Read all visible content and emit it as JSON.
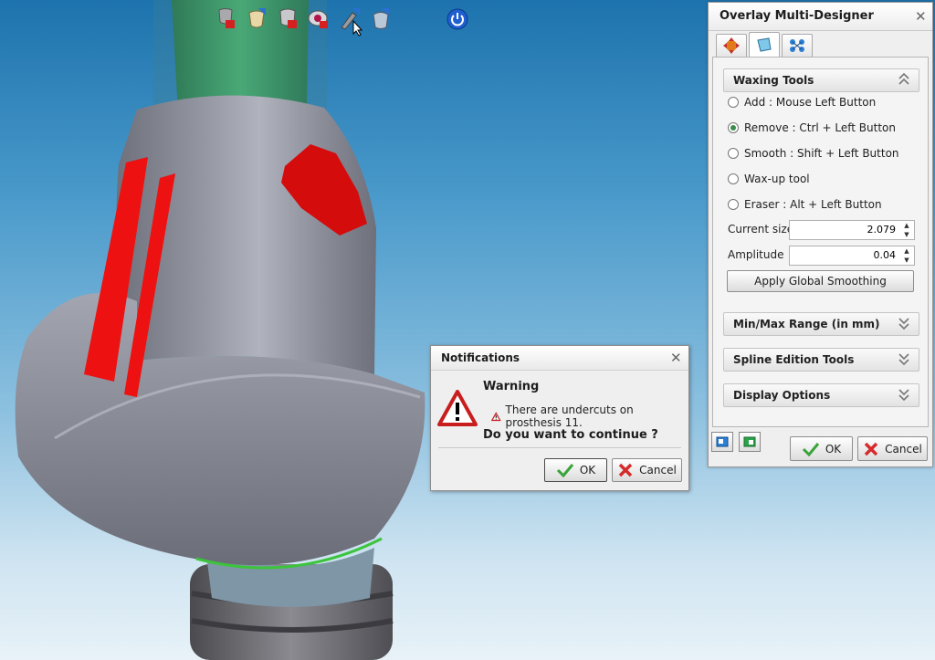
{
  "toolbar": {
    "icons": [
      "tooth-remove-icon",
      "tooth-add-icon",
      "tooth-cut-icon",
      "tooth-view-icon",
      "wax-pen-icon",
      "tooth-shape-icon",
      "power-icon"
    ]
  },
  "panel": {
    "title": "Overlay Multi-Designer",
    "tabs": [
      "move-icon",
      "wax-tool-icon",
      "nodes-icon"
    ],
    "active_tab": 1,
    "waxing": {
      "header": "Waxing Tools",
      "options": [
        {
          "label": "Add : Mouse Left Button",
          "selected": false
        },
        {
          "label": "Remove : Ctrl + Left Button",
          "selected": true
        },
        {
          "label": "Smooth : Shift + Left Button",
          "selected": false
        },
        {
          "label": "Wax-up tool",
          "selected": false
        },
        {
          "label": "Eraser : Alt + Left Button",
          "selected": false
        }
      ],
      "current_size_label": "Current size",
      "current_size_value": "2.079",
      "amplitude_label": "Amplitude",
      "amplitude_value": "0.04",
      "apply_label": "Apply Global Smoothing"
    },
    "sections": [
      "Min/Max Range (in mm)",
      "Spline Edition Tools",
      "Display Options"
    ],
    "ok_label": "OK",
    "cancel_label": "Cancel"
  },
  "dialog": {
    "title": "Notifications",
    "heading": "Warning",
    "message": "There are undercuts on prosthesis 11.",
    "question": "Do you want to continue ?",
    "ok_label": "OK",
    "cancel_label": "Cancel"
  },
  "colors": {
    "accent_green": "#3aa33a",
    "cancel_red": "#d62b2b",
    "undercut_red": "#ee1111",
    "abutment_gray": "#8a8c98"
  }
}
